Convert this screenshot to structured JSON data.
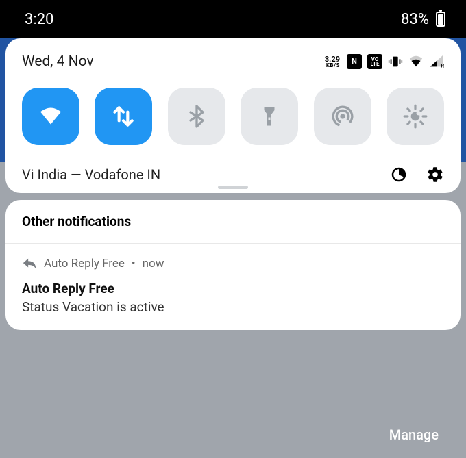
{
  "status_bar": {
    "time": "3:20",
    "battery_percent": "83%"
  },
  "quick_settings": {
    "date": "Wed, 4 Nov",
    "data_speed_value": "3.29",
    "data_speed_unit": "KB/S",
    "nfc": "N",
    "volte_top": "VO",
    "volte_bot": "LTE",
    "carrier": "Vi India — Vodafone IN",
    "toggles": [
      {
        "name": "wifi",
        "on": true
      },
      {
        "name": "mobile-data",
        "on": true
      },
      {
        "name": "bluetooth",
        "on": false
      },
      {
        "name": "flashlight",
        "on": false
      },
      {
        "name": "hotspot",
        "on": false
      },
      {
        "name": "brightness",
        "on": false
      }
    ]
  },
  "notifications": {
    "group_title": "Other notifications",
    "item": {
      "app": "Auto Reply Free",
      "sep": "•",
      "time": "now",
      "title": "Auto Reply Free",
      "body": "Status Vacation is active"
    }
  },
  "manage_label": "Manage"
}
